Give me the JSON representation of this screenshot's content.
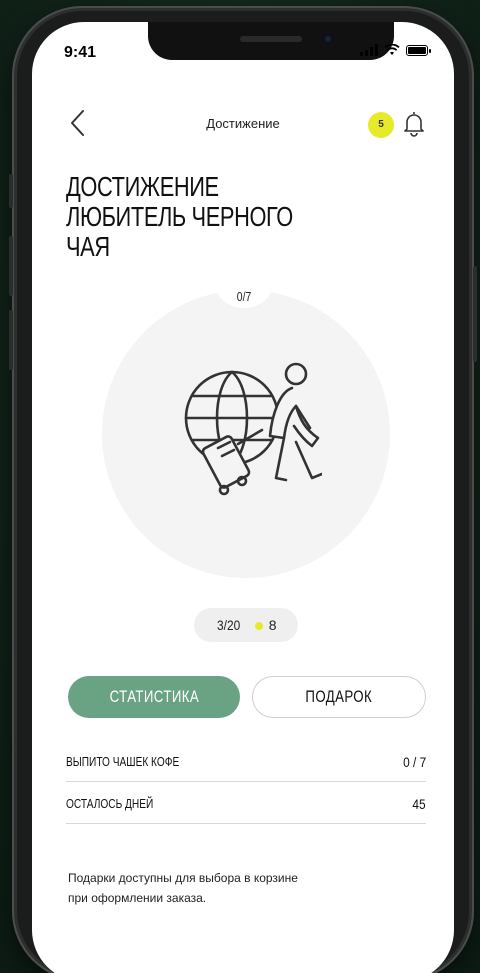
{
  "status_bar": {
    "time": "9:41"
  },
  "nav": {
    "title": "Достижение",
    "points": "5"
  },
  "headline": [
    "ДОСТИЖЕНИЕ",
    "ЛЮБИТЕЛЬ ЧЕРНОГО",
    "ЧАЯ"
  ],
  "progress": {
    "label": "0/7"
  },
  "mini_stats": {
    "count": "3/20",
    "points": "8"
  },
  "tabs": {
    "stats_label": "СТАТИСТИКА",
    "gift_label": "ПОДАРОК",
    "active": "stats"
  },
  "stats_rows": [
    {
      "label": "ВЫПИТО ЧАШЕК КОФЕ",
      "value": "0 / 7"
    },
    {
      "label": "ОСТАЛОСЬ ДНЕЙ",
      "value": "45"
    }
  ],
  "note": "Подарки доступны для выбора в корзине при оформлении заказа.",
  "colors": {
    "accent_green": "#6aa383",
    "badge_yellow": "#e6ea2a",
    "background": "#13261c"
  },
  "icons": [
    "back-arrow-icon",
    "bell-icon",
    "globe-traveler-icon",
    "wifi-icon",
    "signal-icon",
    "battery-icon"
  ]
}
